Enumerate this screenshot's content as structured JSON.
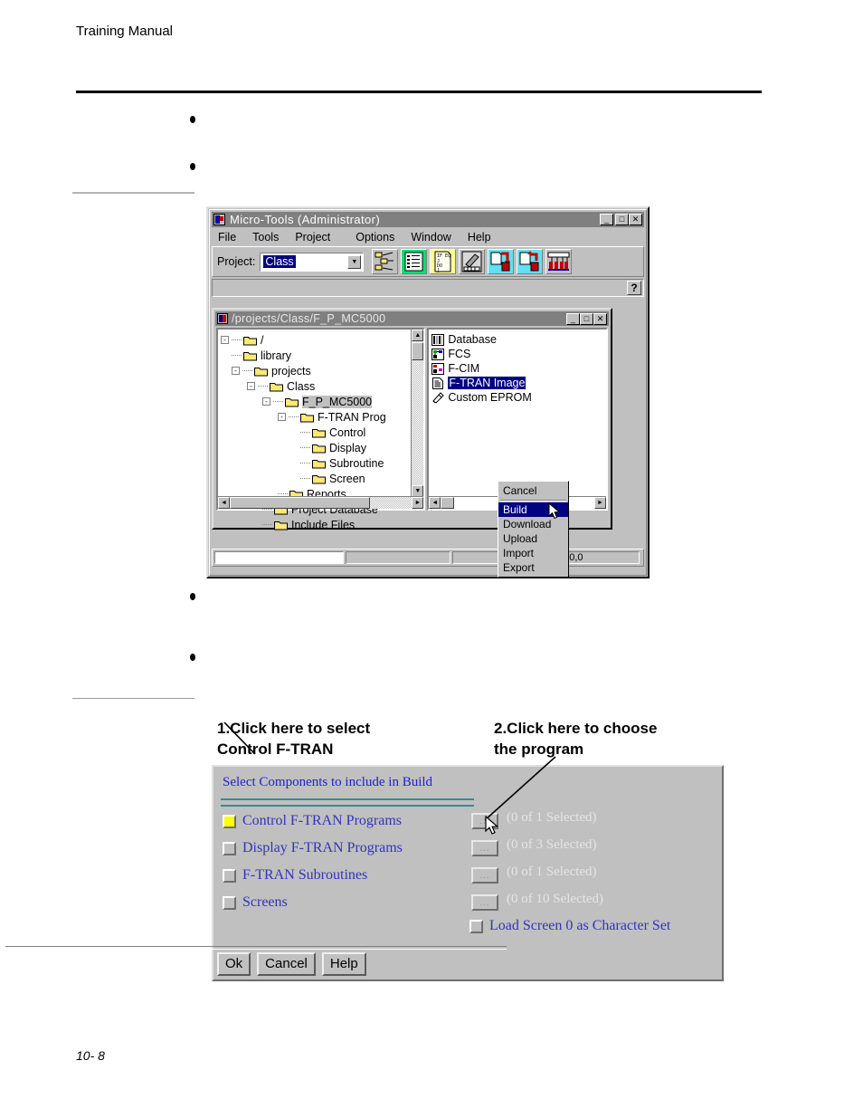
{
  "document": {
    "header_title": "Training Manual",
    "footer_page": "10- 8",
    "bullets": [
      "",
      "",
      "",
      ""
    ]
  },
  "app_window": {
    "title": "Micro-Tools (Administrator)",
    "title_icon": "app-icon",
    "window_buttons": [
      {
        "name": "minimize-button",
        "glyph": "_"
      },
      {
        "name": "maximize-button",
        "glyph": "□"
      },
      {
        "name": "close-button",
        "glyph": "✕"
      }
    ],
    "menu": [
      "File",
      "Tools",
      "Project",
      "Options",
      "Window",
      "Help"
    ],
    "toolbar": {
      "project_label": "Project:",
      "project_value": "Class",
      "dropdown_arrow": "▼",
      "buttons": [
        {
          "name": "tree-tool-icon",
          "title": "hierarchy"
        },
        {
          "name": "database-tool-icon",
          "title": "database"
        },
        {
          "name": "program-tool-icon",
          "title": "program"
        },
        {
          "name": "build-tool-icon",
          "title": "build"
        },
        {
          "name": "download-tool-icon",
          "title": "download"
        },
        {
          "name": "upload-tool-icon",
          "title": "upload"
        },
        {
          "name": "eprom-tool-icon",
          "title": "eprom"
        }
      ]
    },
    "help_button": "?",
    "status_cells": [
      "",
      "",
      "",
      "0,0"
    ]
  },
  "mdi_window": {
    "title": "/projects/Class/F_P_MC5000",
    "title_icon": "project-icon",
    "window_buttons": [
      {
        "name": "mdi-minimize-button",
        "glyph": "_"
      },
      {
        "name": "mdi-maximize-button",
        "glyph": "□"
      },
      {
        "name": "mdi-close-button",
        "glyph": "✕"
      }
    ],
    "tree": [
      {
        "label": "/",
        "depth": 0,
        "expander": "-",
        "selected": false
      },
      {
        "label": "library",
        "depth": 1,
        "expander": "",
        "selected": false
      },
      {
        "label": "projects",
        "depth": 1,
        "expander": "-",
        "selected": false
      },
      {
        "label": "Class",
        "depth": 2,
        "expander": "-",
        "selected": false
      },
      {
        "label": "F_P_MC5000",
        "depth": 3,
        "expander": "-",
        "selected": true
      },
      {
        "label": "F-TRAN Prog",
        "depth": 4,
        "expander": "-",
        "selected": false
      },
      {
        "label": "Control",
        "depth": 5,
        "expander": "",
        "selected": false
      },
      {
        "label": "Display",
        "depth": 5,
        "expander": "",
        "selected": false
      },
      {
        "label": "Subroutine",
        "depth": 5,
        "expander": "",
        "selected": false
      },
      {
        "label": "Screen",
        "depth": 5,
        "expander": "",
        "selected": false
      },
      {
        "label": "Reports",
        "depth": 4,
        "expander": "",
        "selected": false
      },
      {
        "label": "Project Database",
        "depth": 3,
        "expander": "",
        "selected": false
      },
      {
        "label": "Include Files",
        "depth": 3,
        "expander": "",
        "selected": false
      }
    ],
    "list": [
      {
        "label": "Database",
        "icon": "database-icon",
        "selected": false
      },
      {
        "label": "FCS",
        "icon": "fcs-icon",
        "selected": false
      },
      {
        "label": "F-CIM",
        "icon": "fcim-icon",
        "selected": false
      },
      {
        "label": "F-TRAN Image",
        "icon": "document-icon",
        "selected": true
      },
      {
        "label": "Custom EPROM",
        "icon": "eprom-icon",
        "selected": false
      }
    ]
  },
  "context_menu": {
    "items": [
      {
        "label": "Cancel",
        "highlighted": false,
        "separator_after": true
      },
      {
        "label": "Build",
        "highlighted": true,
        "separator_after": false
      },
      {
        "label": "Download",
        "highlighted": false,
        "separator_after": false
      },
      {
        "label": "Upload",
        "highlighted": false,
        "separator_after": false
      },
      {
        "label": "Import",
        "highlighted": false,
        "separator_after": false
      },
      {
        "label": "Export",
        "highlighted": false,
        "separator_after": false
      }
    ]
  },
  "annotations": [
    {
      "name": "annotation-1",
      "text": "1.Click here to select\nControl F-TRAN"
    },
    {
      "name": "annotation-2",
      "text": "2.Click here to choose\nthe program"
    }
  ],
  "build_dialog": {
    "heading": "Select Components to include in Build",
    "rows": [
      {
        "label": "Control F-TRAN Programs",
        "checked": true,
        "count": "(0 of 1 Selected)",
        "dots": "..."
      },
      {
        "label": "Display F-TRAN Programs",
        "checked": false,
        "count": "(0 of 3 Selected)",
        "dots": "..."
      },
      {
        "label": "F-TRAN Subroutines",
        "checked": false,
        "count": "(0 of 1 Selected)",
        "dots": "..."
      },
      {
        "label": "Screens",
        "checked": false,
        "count": "(0 of 10 Selected)",
        "dots": "..."
      }
    ],
    "load_screen": {
      "label": "Load Screen 0 as Character Set",
      "checked": false
    },
    "buttons": [
      "Ok",
      "Cancel",
      "Help"
    ]
  },
  "colors": {
    "win_face": "#c0c0c0",
    "titlebar": "#808080",
    "selection_blue": "#000080",
    "dialog_text_blue": "#3333bb",
    "divider_teal": "#2f8f8f",
    "checked_yellow": "#ffff00",
    "count_grey": "#e4e4e4"
  }
}
